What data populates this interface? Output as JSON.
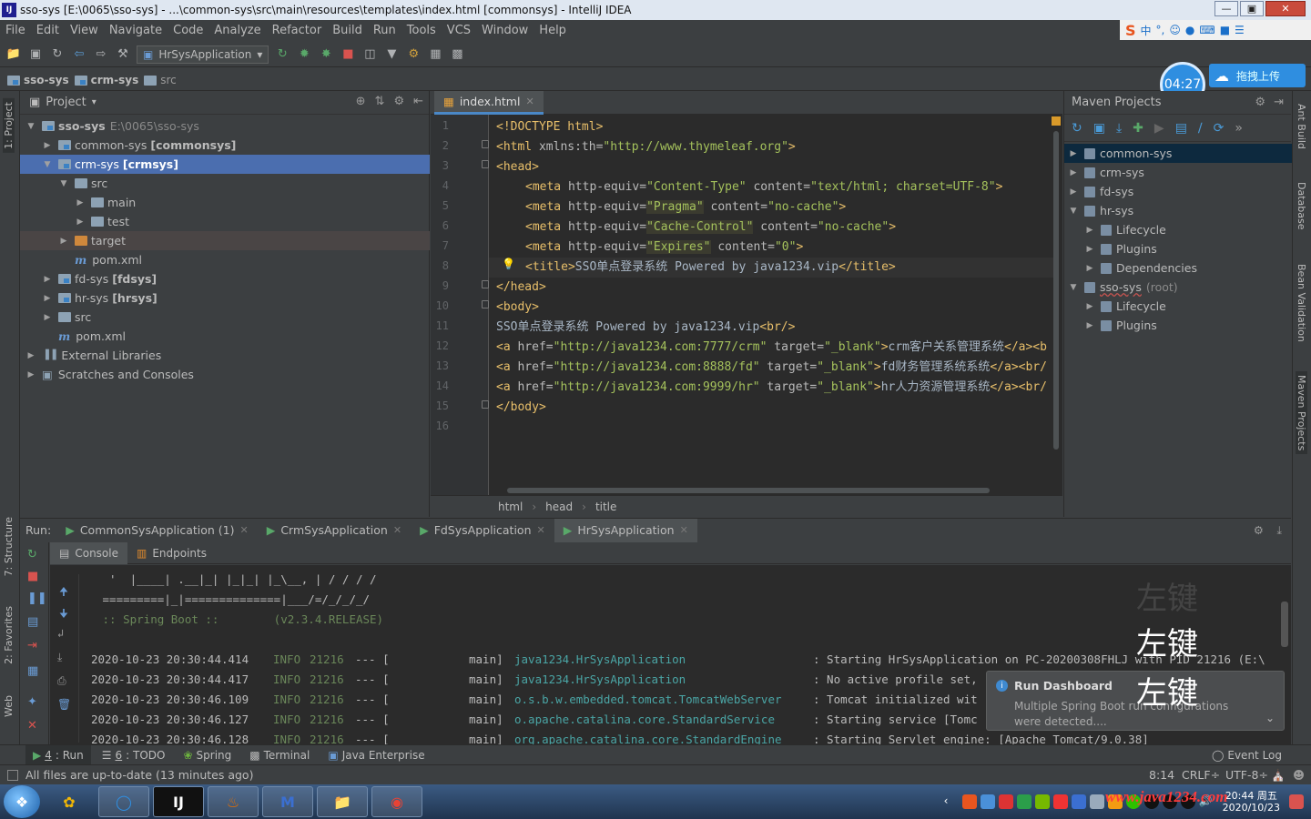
{
  "window": {
    "title": "sso-sys [E:\\0065\\sso-sys] - ...\\common-sys\\src\\main\\resources\\templates\\index.html [commonsys] - IntelliJ IDEA",
    "logo": "IJ"
  },
  "menu": [
    "File",
    "Edit",
    "View",
    "Navigate",
    "Code",
    "Analyze",
    "Refactor",
    "Build",
    "Run",
    "Tools",
    "VCS",
    "Window",
    "Help"
  ],
  "ime": {
    "label": "中"
  },
  "toolbar": {
    "run_config": "HrSysApplication"
  },
  "navbar": [
    "sso-sys",
    "crm-sys",
    "src"
  ],
  "timer": "04:27",
  "upload_label": "拖拽上传",
  "left_stripe": {
    "project": "1: Project",
    "structure": "7: Structure",
    "favorites": "2: Favorites",
    "web": "Web"
  },
  "project": {
    "title": "Project",
    "tree": [
      {
        "label": "sso-sys",
        "path": "E:\\0065\\sso-sys",
        "depth": 0,
        "expanded": true,
        "bold": true
      },
      {
        "label": "common-sys",
        "module": "[commonsys]",
        "depth": 1,
        "expanded": false
      },
      {
        "label": "crm-sys",
        "module": "[crmsys]",
        "depth": 1,
        "expanded": true,
        "selected": true
      },
      {
        "label": "src",
        "depth": 2,
        "expanded": true
      },
      {
        "label": "main",
        "depth": 3,
        "expanded": false
      },
      {
        "label": "test",
        "depth": 3,
        "expanded": false
      },
      {
        "label": "target",
        "depth": 2,
        "expanded": false
      },
      {
        "label": "pom.xml",
        "depth": 2
      },
      {
        "label": "fd-sys",
        "module": "[fdsys]",
        "depth": 1,
        "expanded": false
      },
      {
        "label": "hr-sys",
        "module": "[hrsys]",
        "depth": 1,
        "expanded": false
      },
      {
        "label": "src",
        "depth": 1,
        "expanded": false
      },
      {
        "label": "pom.xml",
        "depth": 1
      },
      {
        "label": "External Libraries",
        "depth": 0,
        "expanded": false
      },
      {
        "label": "Scratches and Consoles",
        "depth": 0,
        "expanded": false
      }
    ]
  },
  "editor": {
    "tab": "index.html",
    "lines": [
      "1",
      "2",
      "3",
      "4",
      "5",
      "6",
      "7",
      "8",
      "9",
      "10",
      "11",
      "12",
      "13",
      "14",
      "15",
      "16"
    ],
    "code": {
      "l1": "<!DOCTYPE html>",
      "l2a": "<html ",
      "l2b": "xmlns:th=",
      "l2c": "\"http://www.thymeleaf.org\"",
      "l2d": ">",
      "l3": "<head>",
      "l4a": "<meta ",
      "l4b": "http-equiv=",
      "l4c": "\"Content-Type\"",
      "l4d": " content=",
      "l4e": "\"text/html; charset=UTF-8\"",
      "l4f": ">",
      "l5a": "<meta ",
      "l5b": "http-equiv=",
      "l5c": "\"Pragma\"",
      "l5d": " content=",
      "l5e": "\"no-cache\"",
      "l5f": ">",
      "l6a": "<meta ",
      "l6b": "http-equiv=",
      "l6c": "\"Cache-Control\"",
      "l6d": " content=",
      "l6e": "\"no-cache\"",
      "l6f": ">",
      "l7a": "<meta ",
      "l7b": "http-equiv=",
      "l7c": "\"Expires\"",
      "l7d": " content=",
      "l7e": "\"0\"",
      "l7f": ">",
      "l8a": "<title>",
      "l8b": "SSO单点登录系统 Powered by java1234.vip",
      "l8c": "</title>",
      "l9": "</head>",
      "l10": "<body>",
      "l11a": "SSO单点登录系统 Powered by java1234.vip",
      "l11b": "<br/>",
      "l12a": "<a ",
      "l12b": "href=",
      "l12c": "\"http://java1234.com:7777/crm\"",
      "l12d": " target=",
      "l12e": "\"_blank\"",
      "l12f": ">",
      "l12g": "crm客户关系管理系统",
      "l12h": "</a><b",
      "l13a": "<a ",
      "l13b": "href=",
      "l13c": "\"http://java1234.com:8888/fd\"",
      "l13d": " target=",
      "l13e": "\"_blank\"",
      "l13f": ">",
      "l13g": "fd财务管理系统系统",
      "l13h": "</a><br/",
      "l14a": "<a ",
      "l14b": "href=",
      "l14c": "\"http://java1234.com:9999/hr\"",
      "l14d": " target=",
      "l14e": "\"_blank\"",
      "l14f": ">",
      "l14g": "hr人力资源管理系统",
      "l14h": "</a><br/",
      "l15": "</body>"
    },
    "breadcrumb": [
      "html",
      "head",
      "title"
    ]
  },
  "maven": {
    "title": "Maven Projects",
    "tree": [
      {
        "label": "common-sys",
        "depth": 0,
        "selected": true
      },
      {
        "label": "crm-sys",
        "depth": 0
      },
      {
        "label": "fd-sys",
        "depth": 0
      },
      {
        "label": "hr-sys",
        "depth": 0,
        "expanded": true
      },
      {
        "label": "Lifecycle",
        "depth": 1
      },
      {
        "label": "Plugins",
        "depth": 1
      },
      {
        "label": "Dependencies",
        "depth": 1
      },
      {
        "label": "sso-sys",
        "suffix": "(root)",
        "depth": 0,
        "expanded": true
      },
      {
        "label": "Lifecycle",
        "depth": 1
      },
      {
        "label": "Plugins",
        "depth": 1
      }
    ]
  },
  "right_stripe": {
    "ant": "Ant Build",
    "database": "Database",
    "bean": "Bean Validation",
    "maven": "Maven Projects"
  },
  "run": {
    "label": "Run:",
    "tabs": [
      "CommonSysApplication (1)",
      "CrmSysApplication",
      "FdSysApplication",
      "HrSysApplication"
    ],
    "subtabs": [
      "Console",
      "Endpoints"
    ],
    "console": {
      "banner1": "  '  |____| .__|_| |_|_| |_\\__, | / / / /",
      "banner2": " =========|_|==============|___/=/_/_/_/",
      "banner3": " :: Spring Boot ::        (v2.3.4.RELEASE)",
      "logs": [
        {
          "time": "2020-10-23 20:30:44.414",
          "level": "INFO",
          "pid": "21216",
          "sep": "--- [",
          "thread": "main]",
          "cls": "java1234.HrSysApplication",
          "msg": ": Starting HrSysApplication on PC-20200308FHLJ with PID 21216 (E:\\"
        },
        {
          "time": "2020-10-23 20:30:44.417",
          "level": "INFO",
          "pid": "21216",
          "sep": "--- [",
          "thread": "main]",
          "cls": "java1234.HrSysApplication",
          "msg": ": No active profile set,"
        },
        {
          "time": "2020-10-23 20:30:46.109",
          "level": "INFO",
          "pid": "21216",
          "sep": "--- [",
          "thread": "main]",
          "cls": "o.s.b.w.embedded.tomcat.TomcatWebServer",
          "msg": ": Tomcat initialized wit"
        },
        {
          "time": "2020-10-23 20:30:46.127",
          "level": "INFO",
          "pid": "21216",
          "sep": "--- [",
          "thread": "main]",
          "cls": "o.apache.catalina.core.StandardService",
          "msg": ": Starting service [Tomc"
        },
        {
          "time": "2020-10-23 20:30:46.128",
          "level": "INFO",
          "pid": "21216",
          "sep": "--- [",
          "thread": "main]",
          "cls": "org.apache.catalina.core.StandardEngine",
          "msg": ": Starting Servlet engine: [Apache Tomcat/9.0.38]"
        }
      ]
    }
  },
  "notification": {
    "title": "Run Dashboard",
    "body": "Multiple Spring Boot run configurations were detected...."
  },
  "overlay_text": "左键",
  "bottom_tools": [
    {
      "num": "4",
      "label": ": Run"
    },
    {
      "num": "6",
      "label": ": TODO"
    },
    {
      "num": "",
      "label": "Spring"
    },
    {
      "num": "",
      "label": "Terminal"
    },
    {
      "num": "",
      "label": "Java Enterprise"
    }
  ],
  "event_log": "Event Log",
  "status": {
    "message": "All files are up-to-date (13 minutes ago)",
    "position": "8:14",
    "line_sep": "CRLF÷",
    "encoding": "UTF-8÷"
  },
  "taskbar": {
    "clock_time": "20:44 周五",
    "clock_date": "2020/10/23",
    "watermark": "www.java1234.com"
  }
}
